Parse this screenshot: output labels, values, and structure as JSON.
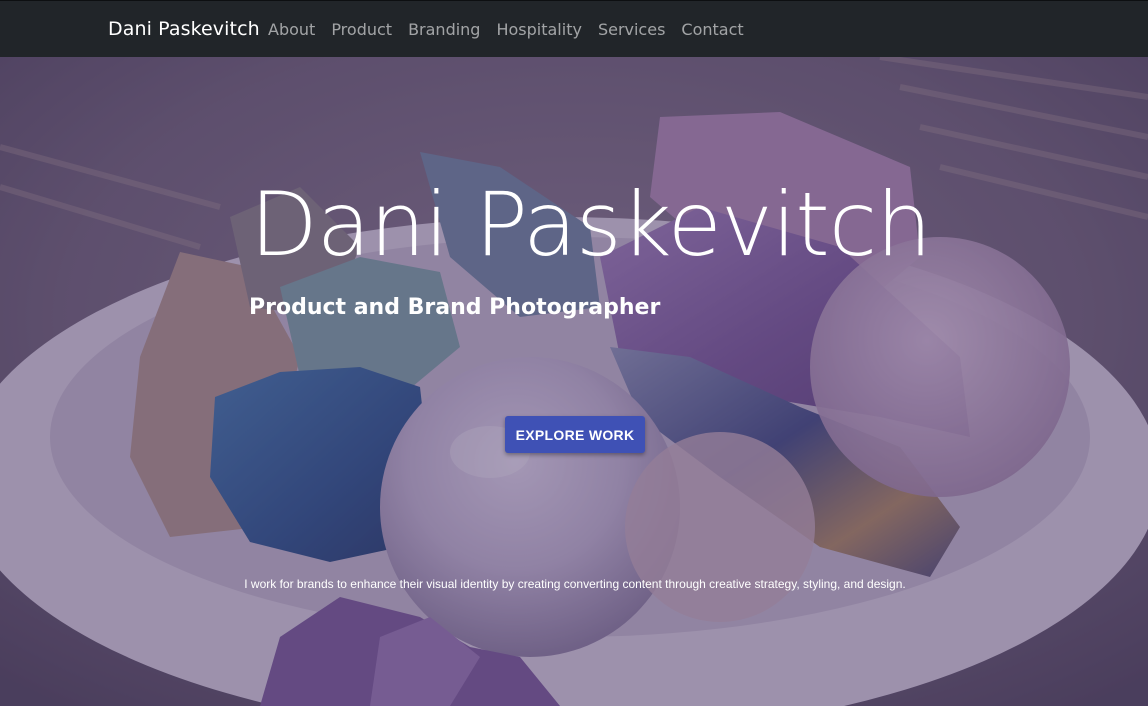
{
  "nav": {
    "brand": "Dani Paskevitch",
    "links": [
      "About",
      "Product",
      "Branding",
      "Hospitality",
      "Services",
      "Contact"
    ]
  },
  "hero": {
    "title": "Dani Paskevitch",
    "subtitle": "Product and Brand Photographer",
    "cta_label": "EXPLORE WORK",
    "tagline": "I work for brands to enhance their visual identity by creating converting content through creative strategy, styling, and design.",
    "image_subject": "crystals-in-white-bowl"
  },
  "colors": {
    "navbar": "#212529",
    "accent": "#3f51b5",
    "overlay": "#463264"
  }
}
